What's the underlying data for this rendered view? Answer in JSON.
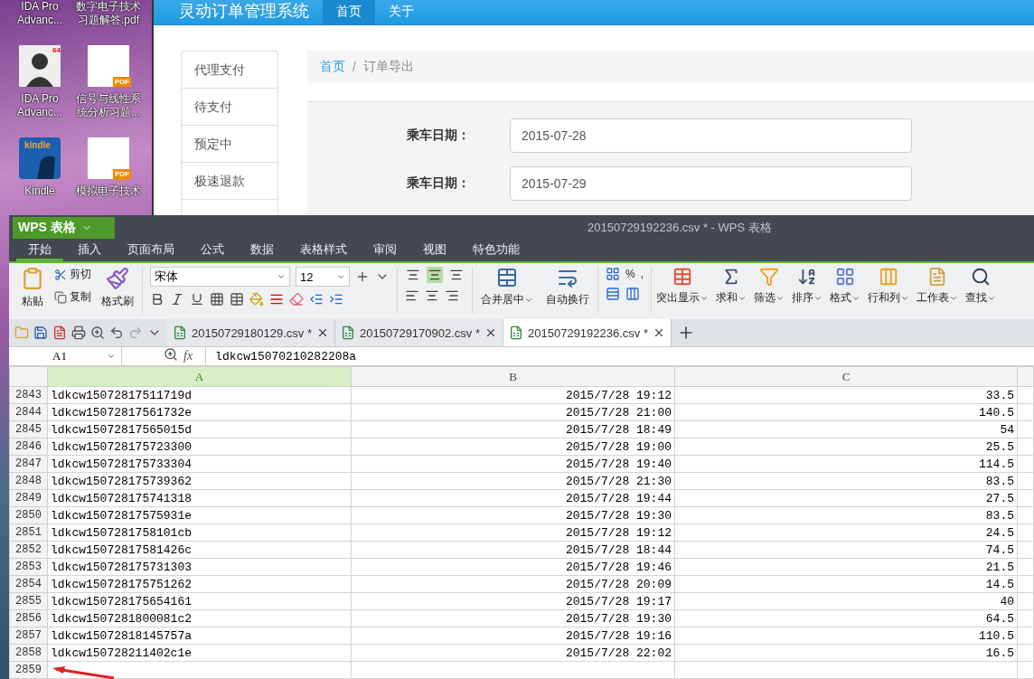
{
  "desktop": {
    "icons": [
      {
        "label": "IDA Pro Advanc...",
        "kind": "text_only"
      },
      {
        "label": "数字电子技术习题解答.pdf",
        "kind": "text_only"
      },
      {
        "label": "IDA Pro Advanc...",
        "kind": "ida",
        "badge": "64"
      },
      {
        "label": "信号与线性系统分析习题...",
        "kind": "pdf",
        "badge": "PDF"
      },
      {
        "label": "Kindle",
        "kind": "kindle",
        "badge": "kindle"
      },
      {
        "label": "模拟电子技术",
        "kind": "pdf",
        "badge": "PDF"
      }
    ]
  },
  "browser": {
    "title": "灵动订单管理系统",
    "nav": [
      {
        "label": "首页",
        "selected": true
      },
      {
        "label": "关于",
        "selected": false
      }
    ],
    "sidebar": [
      "代理支付",
      "待支付",
      "预定中",
      "极速退款"
    ],
    "breadcrumb": [
      {
        "label": "首页",
        "kind": "link"
      },
      {
        "label": "订单导出",
        "kind": "current"
      }
    ],
    "breadcrumb_separator": "/",
    "form": [
      {
        "label": "乘车日期：",
        "value": "2015-07-28"
      },
      {
        "label": "乘车日期：",
        "value": "2015-07-29"
      }
    ]
  },
  "wps": {
    "app_menu": "WPS 表格",
    "title": "20150729192236.csv * - WPS 表格",
    "menu_tabs": [
      {
        "label": "开始",
        "selected": true
      },
      {
        "label": "插入",
        "selected": false
      },
      {
        "label": "页面布局",
        "selected": false
      },
      {
        "label": "公式",
        "selected": false
      },
      {
        "label": "数据",
        "selected": false
      },
      {
        "label": "表格样式",
        "selected": false
      },
      {
        "label": "审阅",
        "selected": false
      },
      {
        "label": "视图",
        "selected": false
      },
      {
        "label": "特色功能",
        "selected": false
      }
    ],
    "clipboard": {
      "paste": "粘贴",
      "cut": "剪切",
      "copy": "复制",
      "painter": "格式刷"
    },
    "font": {
      "name": "宋体",
      "size": "12"
    },
    "merge": "合并居中",
    "wrap": "自动换行",
    "percent": "%",
    "comma": ",",
    "tools": [
      "突出显示",
      "求和",
      "筛选",
      "排序",
      "格式",
      "行和列",
      "工作表",
      "查找"
    ],
    "doc_tabs": [
      {
        "label": "20150729180129.csv *",
        "selected": false
      },
      {
        "label": "20150729170902.csv *",
        "selected": false
      },
      {
        "label": "20150729192236.csv *",
        "selected": true
      }
    ],
    "name_box": "A1",
    "fx": "fx",
    "formula": "ldkcw15070210282208a",
    "columns": [
      {
        "label": "A",
        "selected": true
      },
      {
        "label": "B",
        "selected": false
      },
      {
        "label": "C",
        "selected": false
      }
    ],
    "rows": [
      {
        "num": "2843",
        "cells": [
          "ldkcw15072817511719d",
          "2015/7/28 19:12",
          "33.5"
        ]
      },
      {
        "num": "2844",
        "cells": [
          "ldkcw15072817561732e",
          "2015/7/28 21:00",
          "140.5"
        ]
      },
      {
        "num": "2845",
        "cells": [
          "ldkcw15072817565015d",
          "2015/7/28 18:49",
          "54"
        ]
      },
      {
        "num": "2846",
        "cells": [
          "ldkcw150728175723300",
          "2015/7/28 19:00",
          "25.5"
        ]
      },
      {
        "num": "2847",
        "cells": [
          "ldkcw150728175733304",
          "2015/7/28 19:40",
          "114.5"
        ]
      },
      {
        "num": "2848",
        "cells": [
          "ldkcw150728175739362",
          "2015/7/28 21:30",
          "83.5"
        ]
      },
      {
        "num": "2849",
        "cells": [
          "ldkcw150728175741318",
          "2015/7/28 19:44",
          "27.5"
        ]
      },
      {
        "num": "2850",
        "cells": [
          "ldkcw15072817575931e",
          "2015/7/28 19:30",
          "83.5"
        ]
      },
      {
        "num": "2851",
        "cells": [
          "ldkcw1507281758101cb",
          "2015/7/28 19:12",
          "24.5"
        ]
      },
      {
        "num": "2852",
        "cells": [
          "ldkcw15072817581426c",
          "2015/7/28 18:44",
          "74.5"
        ]
      },
      {
        "num": "2853",
        "cells": [
          "ldkcw150728175731303",
          "2015/7/28 19:46",
          "21.5"
        ]
      },
      {
        "num": "2854",
        "cells": [
          "ldkcw150728175751262",
          "2015/7/28 20:09",
          "14.5"
        ]
      },
      {
        "num": "2855",
        "cells": [
          "ldkcw150728175654161",
          "2015/7/28 19:17",
          "40"
        ]
      },
      {
        "num": "2856",
        "cells": [
          "ldkcw1507281800081c2",
          "2015/7/28 19:30",
          "64.5"
        ]
      },
      {
        "num": "2857",
        "cells": [
          "ldkcw15072818145757a",
          "2015/7/28 19:16",
          "110.5"
        ]
      },
      {
        "num": "2858",
        "cells": [
          "ldkcw150728211402c1e",
          "2015/7/28 22:02",
          "16.5"
        ]
      },
      {
        "num": "2859",
        "cells": []
      }
    ]
  }
}
